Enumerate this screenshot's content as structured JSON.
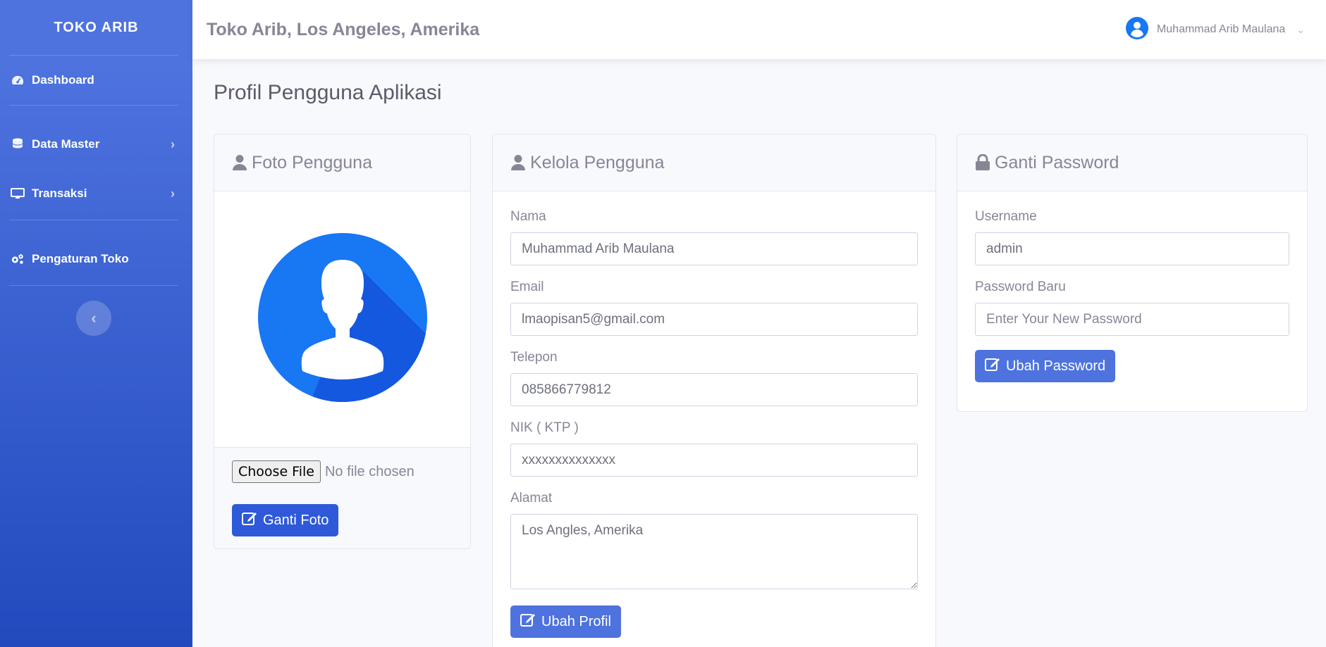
{
  "sidebar": {
    "brand": "TOKO ARIB",
    "items": [
      {
        "label": "Dashboard",
        "icon": "tachometer-icon"
      },
      {
        "label": "Data Master",
        "icon": "database-icon"
      },
      {
        "label": "Transaksi",
        "icon": "desktop-icon"
      },
      {
        "label": "Pengaturan Toko",
        "icon": "cogs-icon"
      }
    ]
  },
  "topbar": {
    "store_name": "Toko Arib, Los Angeles, Amerika",
    "user_name": "Muhammad Arib Maulana"
  },
  "page": {
    "title": "Profil Pengguna Aplikasi"
  },
  "foto": {
    "header": "Foto Pengguna",
    "choose_file": "Choose File",
    "no_file": "No file chosen",
    "button": "Ganti Foto"
  },
  "kelola": {
    "header": "Kelola Pengguna",
    "nama_label": "Nama",
    "nama_value": "Muhammad Arib Maulana",
    "email_label": "Email",
    "email_value": "lmaopisan5@gmail.com",
    "telepon_label": "Telepon",
    "telepon_value": "085866779812",
    "nik_label": "NIK ( KTP )",
    "nik_value": "xxxxxxxxxxxxxx",
    "alamat_label": "Alamat",
    "alamat_value": "Los Angles, Amerika",
    "button": "Ubah Profil"
  },
  "password": {
    "header": "Ganti Password",
    "username_label": "Username",
    "username_value": "admin",
    "new_label": "Password Baru",
    "new_placeholder": "Enter Your New Password",
    "button": "Ubah Password"
  },
  "colors": {
    "primary": "#4e73df",
    "primary_dark": "#224abe",
    "avatar_blue": "#1877f2"
  }
}
